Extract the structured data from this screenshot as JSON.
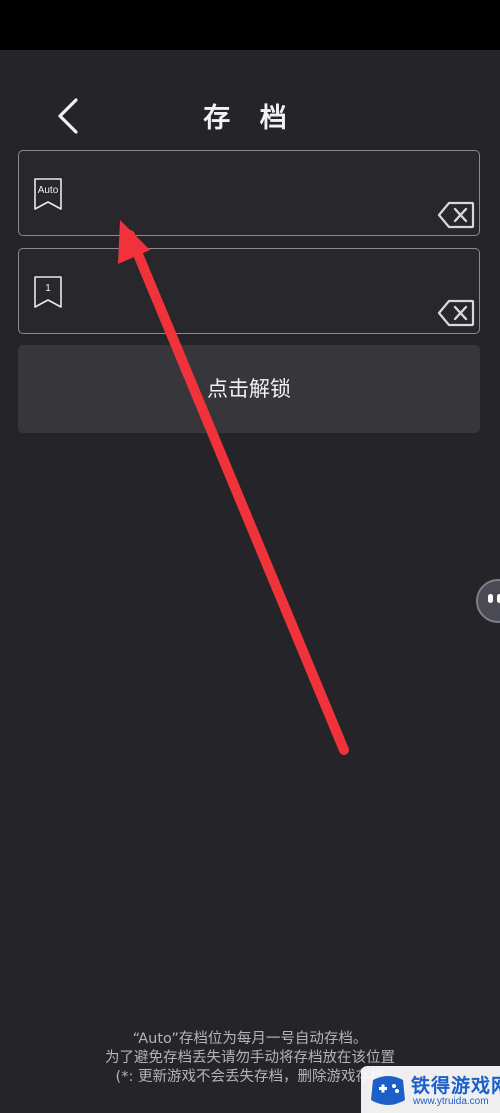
{
  "header": {
    "title": "存 档",
    "back_icon": "chevron-left-icon"
  },
  "slots": [
    {
      "label": "Auto",
      "icon": "bookmark-icon"
    },
    {
      "label": "1",
      "icon": "bookmark-icon"
    }
  ],
  "unlock_button": {
    "label": "点击解锁"
  },
  "footer": {
    "lines": [
      "“Auto”存档位为每月一号自动存档。",
      "为了避免存档丢失请勿手动将存档放在该位置",
      "(*:  更新游戏不会丢失存档，删除游戏存档"
    ]
  },
  "watermark": {
    "name": "铁得游戏网",
    "url": "www.ytruida.com"
  },
  "colors": {
    "background": "#252529",
    "status_bar": "#000000",
    "arrow": "#f0333a",
    "unlock_button": "#36363b",
    "watermark_text": "#1d5fc9"
  }
}
